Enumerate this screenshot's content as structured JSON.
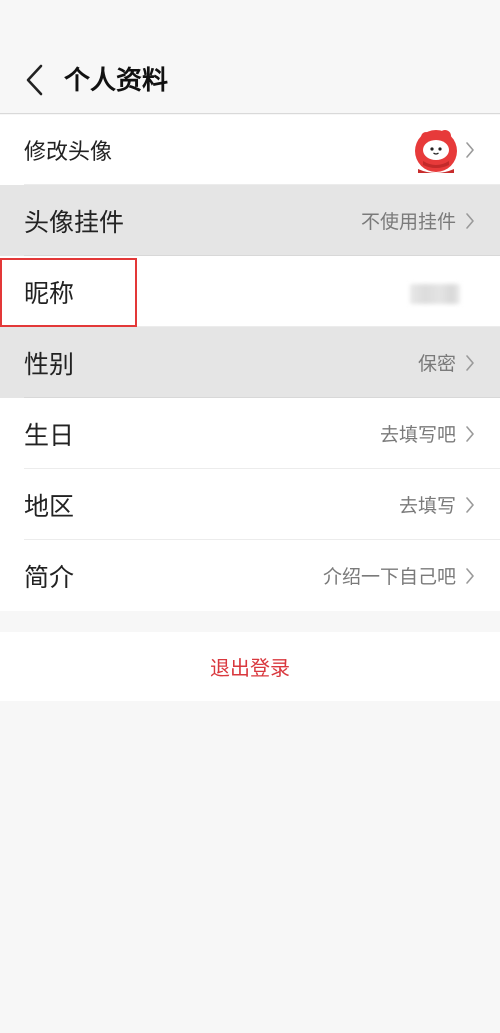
{
  "header": {
    "title": "个人资料",
    "back_icon": "chevron-left-icon"
  },
  "rows": [
    {
      "label": "修改头像",
      "value": "",
      "icon": "avatar-mascot-icon"
    },
    {
      "label": "头像挂件",
      "value": "不使用挂件"
    },
    {
      "label": "昵称",
      "value": ""
    },
    {
      "label": "性别",
      "value": "保密"
    },
    {
      "label": "生日",
      "value": "去填写吧"
    },
    {
      "label": "地区",
      "value": "去填写"
    },
    {
      "label": "简介",
      "value": "介绍一下自己吧"
    }
  ],
  "logout": {
    "label": "退出登录"
  },
  "colors": {
    "accent": "#d9383e",
    "highlight_border": "#e33838",
    "row_shade": "#e5e5e5",
    "page_bg": "#f7f7f7"
  }
}
